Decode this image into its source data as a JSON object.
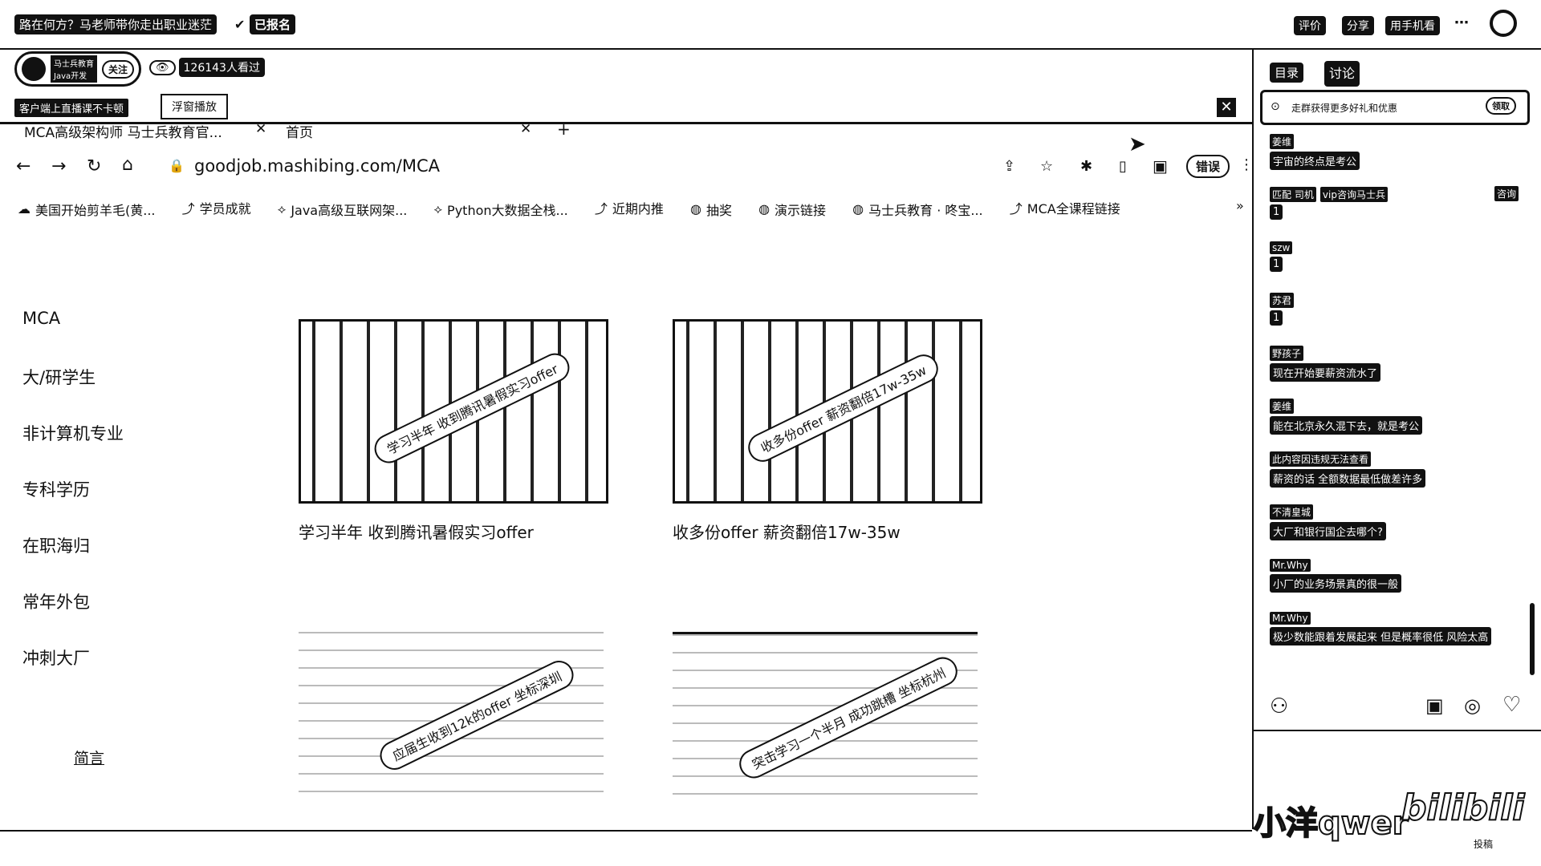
{
  "topbar": {
    "title": "路在何方？马老师带你走出职业迷茫",
    "registered": "已报名",
    "actions": [
      "评价",
      "分享",
      "用手机看"
    ]
  },
  "host": {
    "badge_line1": "马士兵教育",
    "badge_line2": "Java开发",
    "follow": "关注",
    "views": "126143人看过",
    "client_tip": "客户端上直播课不卡顿",
    "popup_tab": "浮窗播放"
  },
  "browser": {
    "tabs": [
      "MCA高级架构师 马士兵教育官...",
      "首页"
    ],
    "url": "goodjob.mashibing.com/MCA",
    "error_label": "错误",
    "bookmarks": [
      "美国开始剪羊毛(黄...",
      "学员成就",
      "Java高级互联网架...",
      "Python大数据全栈...",
      "近期内推",
      "抽奖",
      "演示链接",
      "马士兵教育 · 咚宝...",
      "MCA全课程链接"
    ],
    "sidebar": [
      "MCA",
      "大/研学生",
      "非计算机专业",
      "专科学历",
      "在职海归",
      "常年外包",
      "冲刺大厂"
    ],
    "more_link": "简言",
    "cards": [
      {
        "banner": "学习半年 收到腾讯暑假实习offer",
        "caption": "学习半年 收到腾讯暑假实习offer"
      },
      {
        "banner": "收多份offer 薪资翻倍17w-35w",
        "caption": "收多份offer 薪资翻倍17w-35w"
      },
      {
        "banner": "应届生收到12k的offer 坐标深圳",
        "caption": ""
      },
      {
        "banner": "突击学习一个半月 成功跳槽 坐标杭州",
        "caption": ""
      }
    ]
  },
  "panel": {
    "tabs": [
      "目录",
      "讨论"
    ],
    "notice": "走群获得更多好礼和优惠",
    "notice_btn": "领取",
    "consult": "咨询",
    "messages": [
      {
        "user": "姜维",
        "text": "宇宙的终点是考公"
      },
      {
        "user": "匹配 司机",
        "text": "1",
        "extra": "vip咨询马士兵"
      },
      {
        "user": "szw",
        "text": "1"
      },
      {
        "user": "苏君",
        "text": "1"
      },
      {
        "user": "野孩子",
        "text": "现在开始要薪资流水了"
      },
      {
        "user": "姜维",
        "text": "能在北京永久混下去，就是考公"
      },
      {
        "user": "此内容因违规无法查看",
        "text": "薪资的话 全额数据最低做差许多"
      },
      {
        "user": "不清皇城",
        "text": "大厂和银行国企去哪个?"
      },
      {
        "user": "Mr.Why",
        "text": "小厂的业务场景真的很一般"
      },
      {
        "user": "Mr.Why",
        "text": "极少数能跟着发展起来 但是概率很低 风险太高"
      }
    ],
    "watermark_user": "小洋qwer",
    "watermark_brand": "bilibili",
    "watermark_sub": "投稿"
  }
}
